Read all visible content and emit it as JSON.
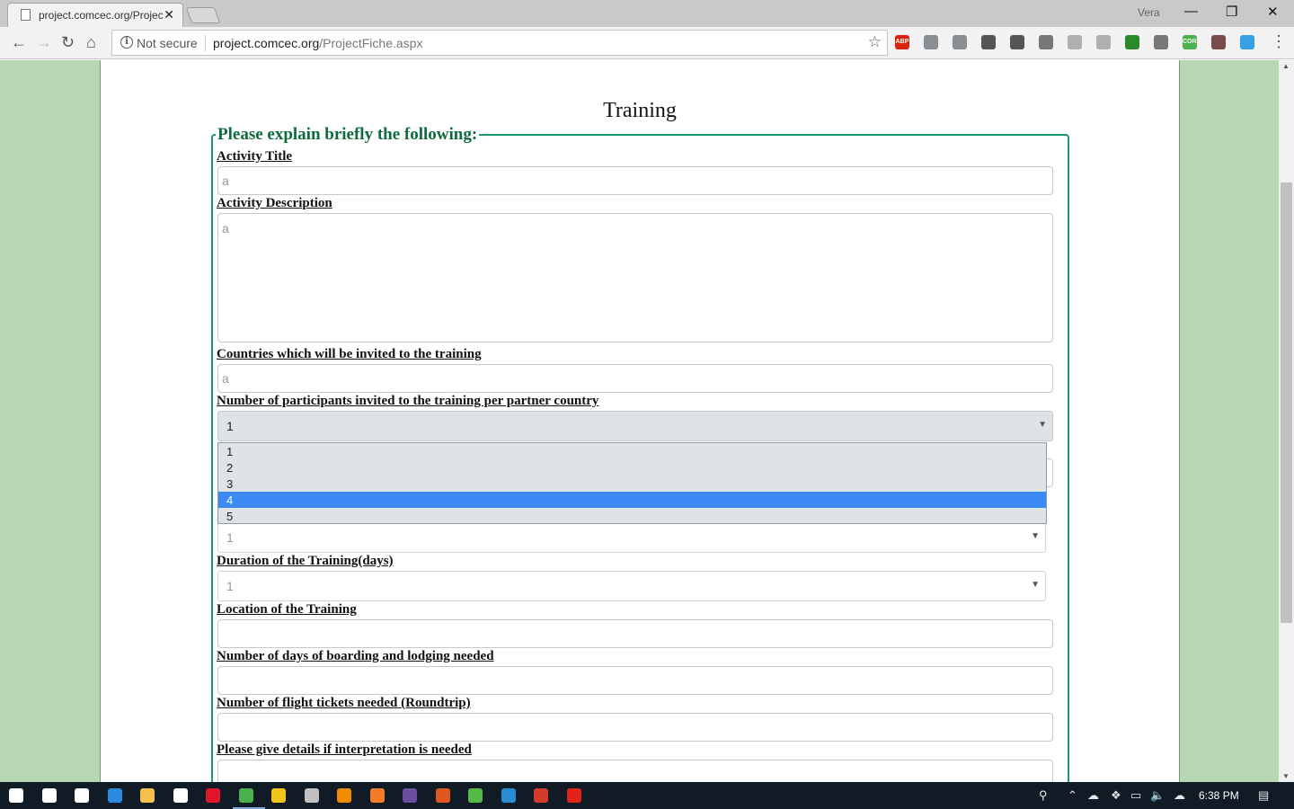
{
  "browser": {
    "tab_title": "project.comcec.org/ProjectFiche.aspx",
    "tab_close": "✕",
    "user_name": "Vera",
    "security_label": "Not secure",
    "url_host": "project.comcec.org",
    "url_path": "/ProjectFiche.aspx",
    "window_minimize": "—",
    "window_restore": "❐",
    "window_close": "✕",
    "extensions": [
      {
        "name": "adblock-icon",
        "text": "ABP",
        "color": "#d9230f"
      },
      {
        "name": "dropbox-icon",
        "text": "",
        "color": "#8a8f96"
      },
      {
        "name": "cloud-icon",
        "text": "",
        "color": "#8a8f96"
      },
      {
        "name": "keeper-icon",
        "text": "",
        "color": "#555555"
      },
      {
        "name": "pocket-icon",
        "text": "",
        "color": "#555555"
      },
      {
        "name": "qr-icon",
        "text": "",
        "color": "#777777"
      },
      {
        "name": "leaf-icon",
        "text": "",
        "color": "#b0b0b0"
      },
      {
        "name": "pdf-icon",
        "text": "",
        "color": "#b0b0b0"
      },
      {
        "name": "globe-icon",
        "text": "",
        "color": "#2c8a2c"
      },
      {
        "name": "copyright-icon",
        "text": "",
        "color": "#777777"
      },
      {
        "name": "cors-icon",
        "text": "CORS",
        "color": "#4caf50"
      },
      {
        "name": "grid-icon",
        "text": "",
        "color": "#7a4b4b"
      },
      {
        "name": "onedrive-icon",
        "text": "",
        "color": "#3aa0e6"
      }
    ]
  },
  "page": {
    "heading": "Training",
    "legend": "Please explain briefly the following:",
    "fields": {
      "activity_title": {
        "label": "Activity Title",
        "value": "a"
      },
      "activity_description": {
        "label": "Activity Description",
        "value": "a"
      },
      "countries": {
        "label": "Countries which will be invited to the training",
        "value": "a"
      },
      "participants": {
        "label": "Number of participants invited to the training per partner country",
        "value": "1"
      },
      "hidden_select": {
        "value": "1"
      },
      "duration": {
        "label": "Duration of the Training(days)",
        "value": "1"
      },
      "location": {
        "label": "Location of the Training",
        "value": ""
      },
      "boarding_days": {
        "label": "Number of days of boarding and lodging needed",
        "value": ""
      },
      "flight_tickets": {
        "label": "Number of flight tickets needed (Roundtrip)",
        "value": ""
      },
      "interpretation": {
        "label": "Please give details if interpretation is needed",
        "value": ""
      }
    },
    "dropdown_options": [
      "1",
      "2",
      "3",
      "4",
      "5"
    ],
    "dropdown_highlighted": "4"
  },
  "taskbar": {
    "clock": "6:38 PM",
    "apps": [
      {
        "name": "windows-start-icon",
        "color": "#ffffff"
      },
      {
        "name": "search-icon",
        "color": "#ffffff"
      },
      {
        "name": "task-view-icon",
        "color": "#ffffff"
      },
      {
        "name": "edge-icon",
        "color": "#2b8ae0"
      },
      {
        "name": "file-explorer-icon",
        "color": "#f2c14e"
      },
      {
        "name": "store-icon",
        "color": "#ffffff"
      },
      {
        "name": "opera-icon",
        "color": "#e0162b"
      },
      {
        "name": "chrome-icon",
        "color": "#4caf50"
      },
      {
        "name": "keepass-icon",
        "color": "#f0c419"
      },
      {
        "name": "tools-icon",
        "color": "#c0c0c0"
      },
      {
        "name": "sublime-icon",
        "color": "#f38b00"
      },
      {
        "name": "xampp-icon",
        "color": "#f37c2a"
      },
      {
        "name": "app-purple-icon",
        "color": "#6b4ea0"
      },
      {
        "name": "app-orange-icon",
        "color": "#e0561f"
      },
      {
        "name": "app-green-icon",
        "color": "#54b948"
      },
      {
        "name": "vscode-icon",
        "color": "#2a8dd4"
      },
      {
        "name": "app-red-icon",
        "color": "#d33c2c"
      },
      {
        "name": "app-red2-icon",
        "color": "#e2231a"
      }
    ]
  }
}
